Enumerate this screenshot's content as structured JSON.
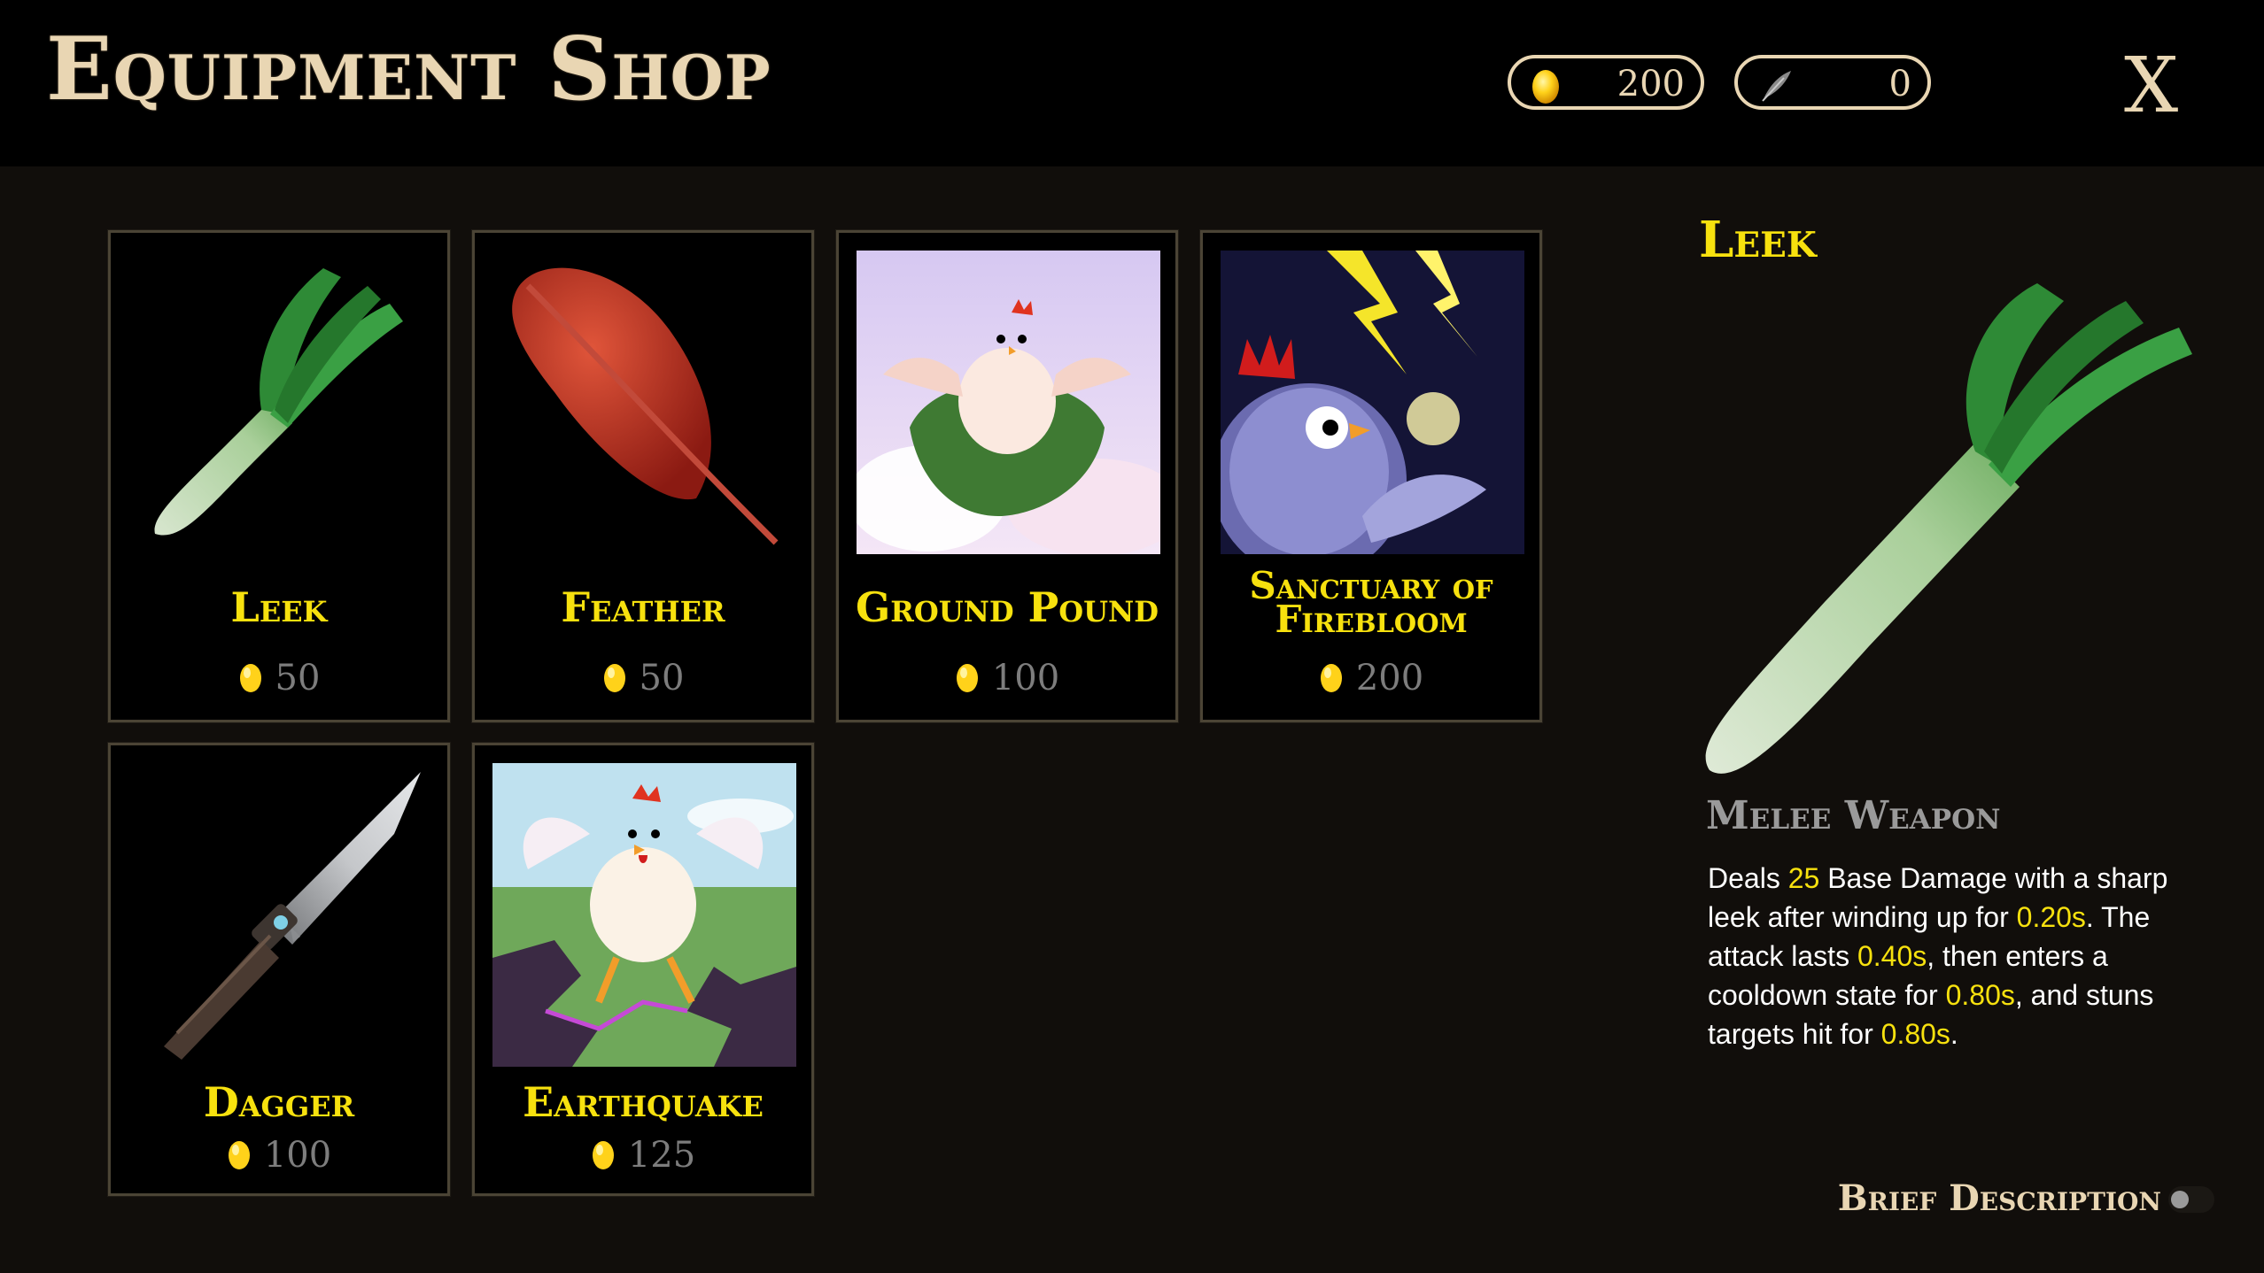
{
  "header": {
    "title": "Equipment Shop",
    "currencies": [
      {
        "icon": "golden-egg-icon",
        "value": "200"
      },
      {
        "icon": "feather-icon",
        "value": "0"
      }
    ],
    "close_label": "X"
  },
  "shop_items": [
    {
      "name": "Leek",
      "price": "50",
      "icon": "leek-icon",
      "price_icon": "golden-egg-icon"
    },
    {
      "name": "Feather",
      "price": "50",
      "icon": "red-feather-icon",
      "price_icon": "golden-egg-icon"
    },
    {
      "name": "Ground Pound",
      "price": "100",
      "icon": "ground-pound-art",
      "price_icon": "golden-egg-icon"
    },
    {
      "name": "Sanctuary of Firebloom",
      "price": "200",
      "icon": "sanctuary-of-firebloom-art",
      "price_icon": "golden-egg-icon"
    },
    {
      "name": "Dagger",
      "price": "100",
      "icon": "dagger-icon",
      "price_icon": "golden-egg-icon"
    },
    {
      "name": "Earthquake",
      "price": "125",
      "icon": "earthquake-art",
      "price_icon": "golden-egg-icon"
    }
  ],
  "detail": {
    "name": "Leek",
    "type": "Melee Weapon",
    "description": {
      "p1": "Deals ",
      "v1": "25",
      "p2": " Base Damage with a sharp leek after winding up for ",
      "v2": "0.20s",
      "p3": ". The attack lasts ",
      "v3": "0.40s",
      "p4": ", then enters a cooldown state for ",
      "v4": "0.80s",
      "p5": ", and stuns targets hit for ",
      "v5": "0.80s",
      "p6": "."
    },
    "brief_toggle_label": "Brief Description",
    "brief_toggle_on": false
  },
  "colors": {
    "accent_yellow": "#f7e10e",
    "parchment": "#e9d6b3",
    "panel_bg": "#110e0b",
    "price_gray": "#7d7d7d"
  }
}
